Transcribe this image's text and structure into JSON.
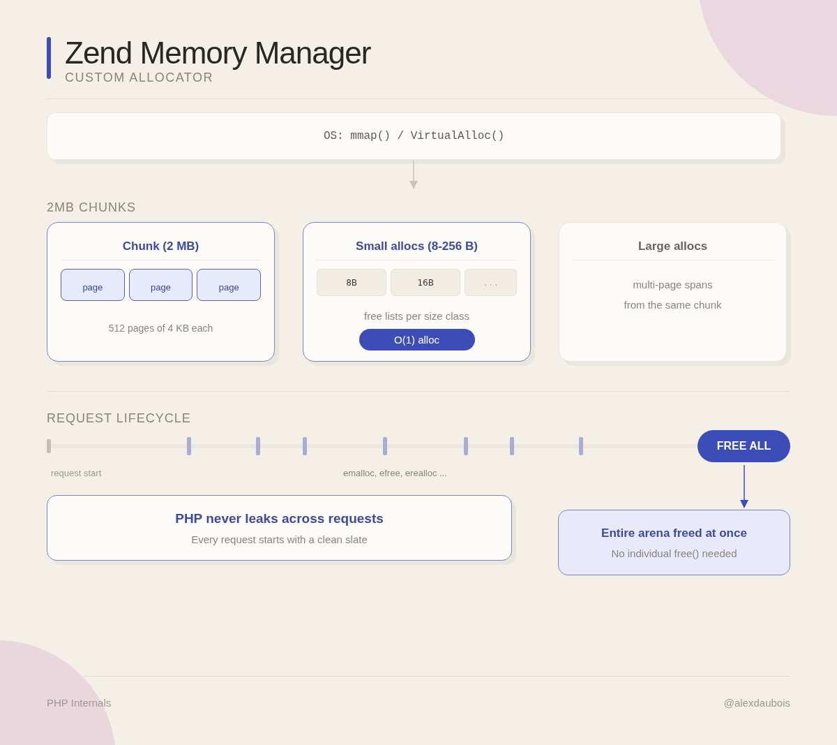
{
  "header": {
    "title": "Zend Memory Manager",
    "subtitle": "CUSTOM ALLOCATOR"
  },
  "os_box": {
    "label": "OS: mmap() / VirtualAlloc()"
  },
  "chunks_section": {
    "heading": "2MB CHUNKS",
    "cards": [
      {
        "kind": "pages",
        "title": "Chunk (2 MB)",
        "highlighted": true,
        "items": [
          {
            "label": "page"
          },
          {
            "label": "page"
          },
          {
            "label": "page"
          }
        ],
        "caption": "512 pages of 4 KB each"
      },
      {
        "kind": "sizes",
        "title": "Small allocs (8-256 B)",
        "highlighted": true,
        "items": [
          {
            "label": "8B",
            "muted": false
          },
          {
            "label": "16B",
            "muted": false
          },
          {
            "label": ". . .",
            "muted": true
          }
        ],
        "caption": "free lists per size class",
        "button": "O(1) alloc"
      },
      {
        "kind": "text",
        "title": "Large allocs",
        "highlighted": false,
        "lines": [
          "multi-page spans",
          "from the same chunk"
        ]
      }
    ]
  },
  "lifecycle": {
    "heading": "REQUEST LIFECYCLE",
    "start_label": "request start",
    "middle_label": "emalloc, efree, erealloc ...",
    "end_button": "FREE ALL"
  },
  "notes": [
    {
      "kind": "plain",
      "title": "PHP never leaks across requests",
      "text": "Every request starts with a clean slate"
    },
    {
      "kind": "accent",
      "title": "Entire arena freed at once",
      "text": "No individual free() needed"
    }
  ],
  "footer": {
    "left": "PHP Internals",
    "right": "@alexdaubois"
  }
}
